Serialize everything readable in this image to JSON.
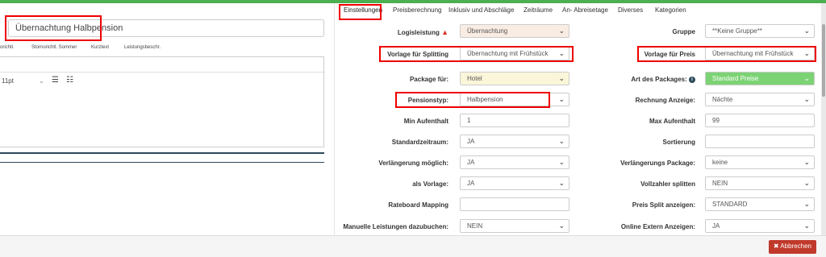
{
  "left": {
    "name_value": "Übernachtung Halbpension",
    "subtabs": [
      "orichtl.",
      "Stornorichtl. Sommer",
      "Kurztext",
      "Leistungsbeschr."
    ],
    "font_size": "11pt",
    "list_icon": "bullet-list-icon",
    "numbered_icon": "numbered-list-icon"
  },
  "tabs": [
    "Einstellungen",
    "Preisberechnung",
    "Inklusiv und Abschläge",
    "Zeiträume",
    "An- Abreisetage",
    "Diverses",
    "Kategorien"
  ],
  "form": {
    "logisleistung": {
      "label": "Logisleistung",
      "value": "Übernachtung"
    },
    "gruppe": {
      "label": "Gruppe",
      "value": "**Keine Gruppe**"
    },
    "vorlage_splitting": {
      "label": "Vorlage für Splitting",
      "value": "Übernachtung mit Frühstück"
    },
    "vorlage_preis": {
      "label": "Vorlage für Preis",
      "value": "Übernachtung mit Frühstück"
    },
    "package_fuer": {
      "label": "Package für:",
      "value": "Hotel"
    },
    "art_packages": {
      "label": "Art des Packages:",
      "value": "Standard Preise"
    },
    "pensionstyp": {
      "label": "Pensionstyp:",
      "value": "Halbpension"
    },
    "rechnung_anzeige": {
      "label": "Rechnung Anzeige:",
      "value": "Nächte"
    },
    "min_aufenthalt": {
      "label": "Min Aufenthalt",
      "value": "1"
    },
    "max_aufenthalt": {
      "label": "Max Aufenthalt",
      "value": "99"
    },
    "standardzeitraum": {
      "label": "Standardzeitraum:",
      "value": "JA"
    },
    "sortierung": {
      "label": "Sortierung",
      "value": ""
    },
    "verlaengerung_moeglich": {
      "label": "Verlängerung möglich:",
      "value": "JA"
    },
    "verlaengerungs_package": {
      "label": "Verlängerungs Package:",
      "value": "keine"
    },
    "als_vorlage": {
      "label": "als Vorlage:",
      "value": "JA"
    },
    "vollzahler_splitten": {
      "label": "Vollzahler splitten",
      "value": "NEIN"
    },
    "rateboard_mapping": {
      "label": "Rateboard Mapping",
      "value": ""
    },
    "preis_split_anzeigen": {
      "label": "Preis Split anzeigen:",
      "value": "STANDARD"
    },
    "manuelle_leistungen": {
      "label": "Manuelle Leistungen dazubuchen:",
      "value": "NEIN"
    },
    "online_extern": {
      "label": "Online Extern Anzeigen:",
      "value": "JA"
    }
  },
  "footer": {
    "cancel_label": "✖ Abbrechen"
  },
  "colors": {
    "accent_green": "#4caf50",
    "highlight_red": "#e00000",
    "cancel_red": "#c0392b"
  }
}
